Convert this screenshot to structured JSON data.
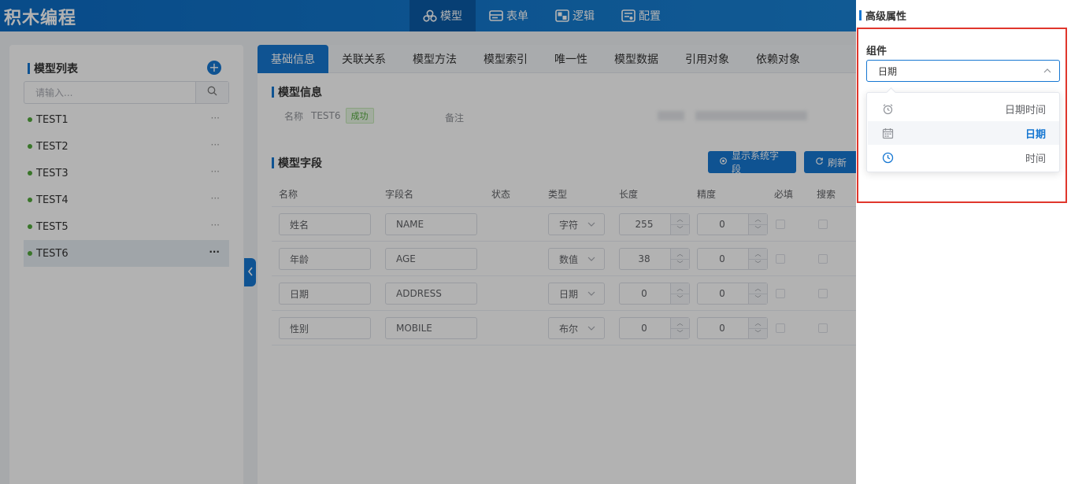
{
  "app": {
    "title": "积木编程"
  },
  "nav": [
    {
      "label": "模型",
      "icon": "cubes-icon",
      "active": true
    },
    {
      "label": "表单",
      "icon": "form-icon",
      "active": false
    },
    {
      "label": "逻辑",
      "icon": "logic-icon",
      "active": false
    },
    {
      "label": "配置",
      "icon": "config-icon",
      "active": false
    }
  ],
  "sidebar": {
    "title": "模型列表",
    "search_placeholder": "请输入...",
    "items": [
      {
        "label": "TEST1"
      },
      {
        "label": "TEST2"
      },
      {
        "label": "TEST3"
      },
      {
        "label": "TEST4"
      },
      {
        "label": "TEST5"
      },
      {
        "label": "TEST6",
        "selected": true
      }
    ],
    "more": "···"
  },
  "tabs": [
    "基础信息",
    "关联关系",
    "模型方法",
    "模型索引",
    "唯一性",
    "模型数据",
    "引用对象",
    "依赖对象"
  ],
  "model_info": {
    "title": "模型信息",
    "name_label": "名称",
    "name_value": "TEST6",
    "status": "成功",
    "remark_label": "备注"
  },
  "fields": {
    "title": "模型字段",
    "show_system_button": "显示系统字段",
    "refresh_button": "刷新",
    "headers": [
      "名称",
      "字段名",
      "状态",
      "类型",
      "长度",
      "精度",
      "必填",
      "搜索"
    ],
    "rows": [
      {
        "name": "姓名",
        "field": "NAME",
        "type": "字符",
        "length": "255",
        "precision": "0"
      },
      {
        "name": "年龄",
        "field": "AGE",
        "type": "数值",
        "length": "38",
        "precision": "0"
      },
      {
        "name": "日期",
        "field": "ADDRESS",
        "type": "日期",
        "length": "0",
        "precision": "0"
      },
      {
        "name": "性别",
        "field": "MOBILE",
        "type": "布尔",
        "length": "0",
        "precision": "0"
      }
    ]
  },
  "drawer": {
    "title": "高级属性",
    "component_label": "组件",
    "component_value": "日期",
    "options": [
      {
        "label": "日期时间",
        "icon": "alarm-clock-icon",
        "active": false
      },
      {
        "label": "日期",
        "icon": "calendar-icon",
        "active": true
      },
      {
        "label": "时间",
        "icon": "clock-icon",
        "active": false
      }
    ]
  },
  "colors": {
    "primary": "#1677d2",
    "highlight": "#e0362c",
    "success": "#52a83c"
  }
}
